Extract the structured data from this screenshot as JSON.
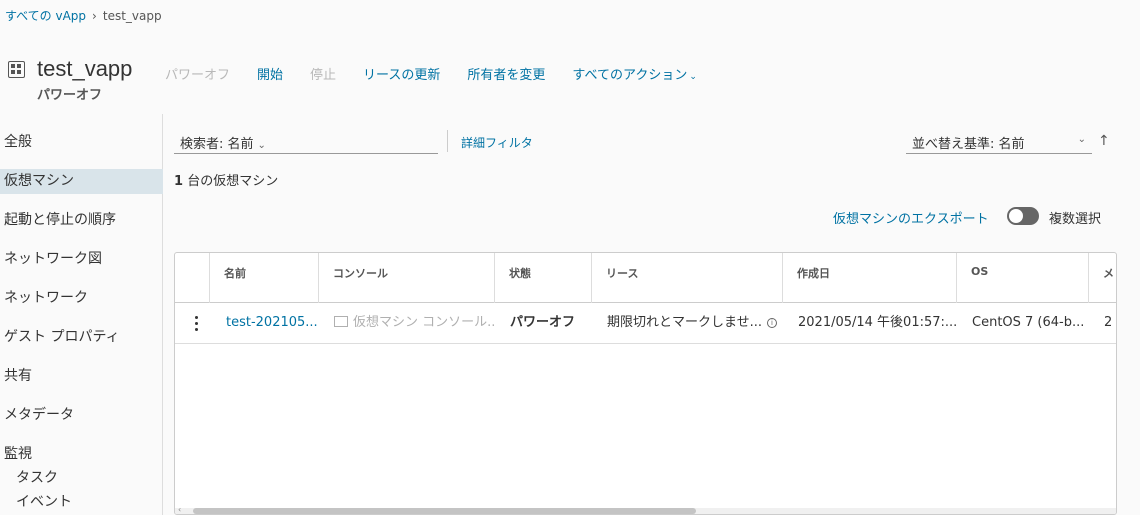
{
  "breadcrumb": {
    "parent": "すべての vApp",
    "separator": "›",
    "current": "test_vapp"
  },
  "header": {
    "title": "test_vapp",
    "status": "パワーオフ",
    "actions": {
      "power_off": "パワーオフ",
      "start": "開始",
      "stop": "停止",
      "renew_lease": "リースの更新",
      "change_owner": "所有者を変更",
      "all_actions": "すべてのアクション"
    }
  },
  "sidebar": {
    "items": [
      "全般",
      "仮想マシン",
      "起動と停止の順序",
      "ネットワーク図",
      "ネットワーク",
      "ゲスト プロパティ",
      "共有",
      "メタデータ",
      "監視"
    ],
    "sub_items": [
      "タスク",
      "イベント"
    ],
    "active_index": 1
  },
  "toolbar": {
    "search_by": "検索者: 名前",
    "advanced_filter": "詳細フィルタ",
    "sort_by": "並べ替え基準: 名前",
    "sort_direction_icon": "arrow-up-icon"
  },
  "summary": {
    "count": "1",
    "count_label": "台の仮想マシン"
  },
  "export": {
    "label": "仮想マシンのエクスポート",
    "multi_select_label": "複数選択",
    "multi_select_on": false
  },
  "table": {
    "columns": [
      "名前",
      "コンソール",
      "状態",
      "リース",
      "作成日",
      "OS",
      "メ"
    ],
    "rows": [
      {
        "name": "test-202105...",
        "console": "仮想マシン コンソール...",
        "state": "パワーオフ",
        "lease": "期限切れとマークしませ...",
        "created": "2021/05/14 午後01:57:...",
        "os": "CentOS 7 (64-b...",
        "extra": "2"
      }
    ]
  },
  "colors": {
    "link": "#0072a3",
    "active_bg": "#d9e4ea",
    "disabled": "#b8b8b8"
  }
}
